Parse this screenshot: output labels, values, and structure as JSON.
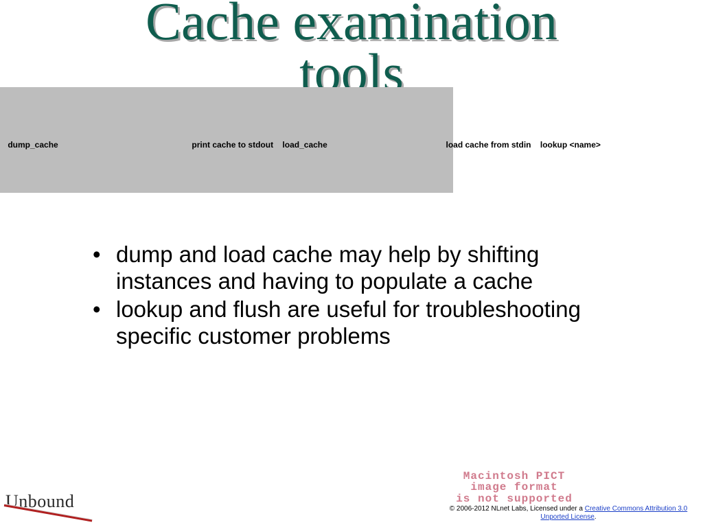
{
  "title_line1": "Cache examination",
  "title_line2": "tools",
  "tools": {
    "cmd1": "dump_cache",
    "desc1": "print cache to stdout",
    "cmd2": "load_cache",
    "desc2": "load cache from stdin",
    "cmd3": "lookup <name>"
  },
  "bullets": [
    "dump and load cache may help by shifting instances and having to populate a cache",
    "lookup and flush are useful for troubleshooting specific customer problems"
  ],
  "logo_text": "Unbound",
  "pict_error": {
    "l1": "Macintosh PICT",
    "l2": "image format",
    "l3": "is not supported"
  },
  "footer": {
    "prefix": "© 2006-2012 NLnet Labs, Licensed under a ",
    "link_text": "Creative Commons Attribution 3.0 Unported License",
    "suffix": "."
  }
}
